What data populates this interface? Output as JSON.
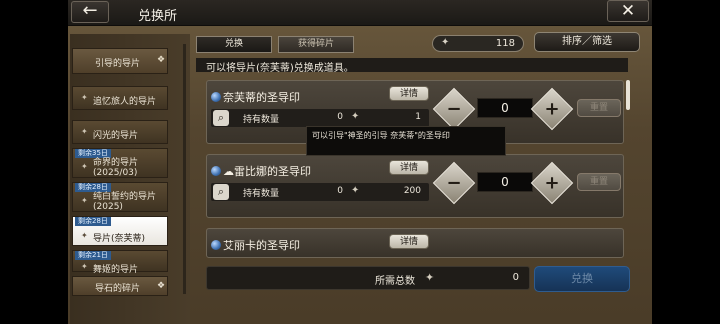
{
  "header": {
    "title": "兑换所",
    "back_icon": "arrow-left-icon",
    "close_icon": "close-icon"
  },
  "sidebar": {
    "items": [
      {
        "label": "引导的导片",
        "badge": ""
      },
      {
        "label": "追忆旅人的导片",
        "badge": ""
      },
      {
        "label": "闪光的导片",
        "badge": ""
      },
      {
        "label": "命界的导片(2025/03)",
        "label_line1": "命界的导片",
        "label_line2": "(2025/03)",
        "badge": "剩余35日"
      },
      {
        "label": "纯白誓约的导片(2025)",
        "label_line1": "纯白誓约的导片",
        "label_line2": "(2025)",
        "badge": "剩余28日"
      },
      {
        "label": "导片(奈芙蒂)",
        "badge": "剩余28日",
        "selected": true
      },
      {
        "label": "舞姬的导片",
        "badge": "剩余21日"
      }
    ],
    "bottom_item": {
      "label": "导石的碎片"
    }
  },
  "tabs": [
    {
      "label": "兑换",
      "active": true
    },
    {
      "label": "获得碎片",
      "active": false
    }
  ],
  "currency": {
    "value": "118"
  },
  "sort_label": "排序／筛选",
  "info_text": "可以将导片(奈芙蒂)兑换成道具。",
  "items": [
    {
      "name": "奈芙蒂的圣导印",
      "detail_label": "详情",
      "hold_label": "持有数量",
      "hold_value": "0",
      "cost": "1",
      "quantity": "0",
      "reset_label": "重置"
    },
    {
      "name": "☁雷比娜的圣导印",
      "detail_label": "详情",
      "hold_label": "持有数量",
      "hold_value": "0",
      "cost": "200",
      "quantity": "0",
      "reset_label": "重置"
    },
    {
      "name": "艾丽卡的圣导印",
      "detail_label": "详情"
    }
  ],
  "tooltip": {
    "text": "可以引导\"神圣的引导 奈芙蒂\"的圣导印"
  },
  "footer": {
    "total_label": "所需总数",
    "total_value": "0",
    "exchange_label": "兑换"
  },
  "colors": {
    "exchange_button": "#1f4a7a",
    "selected_item": "#ffffff",
    "day_badge": "#2e5b8f"
  }
}
